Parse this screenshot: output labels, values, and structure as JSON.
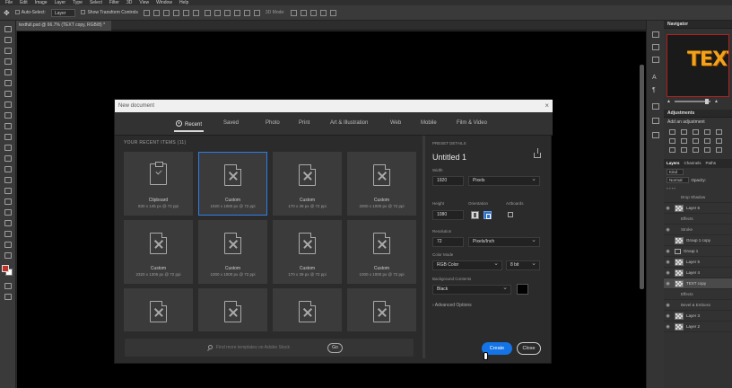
{
  "menubar": [
    "File",
    "Edit",
    "Image",
    "Layer",
    "Type",
    "Select",
    "Filter",
    "3D",
    "View",
    "Window",
    "Help"
  ],
  "options": {
    "auto_select_label": "Auto-Select:",
    "auto_select_value": "Layer",
    "show_transform_label": "Show Transform Controls",
    "mode_3d_label": "3D Mode:"
  },
  "document_tab": "textfull.psd @ 66.7% (TEXT copy, RGB/8) *",
  "navigator": {
    "title": "Navigator",
    "thumbnail_text": "TEXT"
  },
  "adjustments": {
    "title": "Adjustments",
    "add_label": "Add an adjustment"
  },
  "layers_panel": {
    "tabs": [
      "Layers",
      "Channels",
      "Paths"
    ],
    "filter_kind": "Kind",
    "blend_mode": "Normal",
    "opacity_label": "Opacity:",
    "rows": [
      {
        "name": "Drop Shadow",
        "kind": "effect"
      },
      {
        "name": "Layer 6",
        "kind": "layer"
      },
      {
        "name": "Effects",
        "kind": "effect"
      },
      {
        "name": "Stroke",
        "kind": "effect"
      },
      {
        "name": "Group 1 copy",
        "kind": "group"
      },
      {
        "name": "Group 1",
        "kind": "group"
      },
      {
        "name": "Layer 5",
        "kind": "layer"
      },
      {
        "name": "Layer 4",
        "kind": "layer"
      },
      {
        "name": "TEXT copy",
        "kind": "layer"
      },
      {
        "name": "Effects",
        "kind": "effect"
      },
      {
        "name": "Bevel & Emboss",
        "kind": "effect"
      },
      {
        "name": "Layer 3",
        "kind": "layer"
      },
      {
        "name": "Layer 2",
        "kind": "layer"
      }
    ]
  },
  "dialog": {
    "title": "New document",
    "tabs": [
      "Recent",
      "Saved",
      "Photo",
      "Print",
      "Art & Illustration",
      "Web",
      "Mobile",
      "Film & Video"
    ],
    "recent_header": "YOUR RECENT ITEMS (11)",
    "cards": [
      {
        "name": "Clipboard",
        "desc": "830 x 145 px @ 72 ppi",
        "icon": "clipboard"
      },
      {
        "name": "Custom",
        "desc": "1920 x 1080 px @ 72 ppi",
        "icon": "doc",
        "selected": true
      },
      {
        "name": "Custom",
        "desc": "170 x 39 px @ 72 ppi",
        "icon": "doc"
      },
      {
        "name": "Custom",
        "desc": "2000 x 1000 px @ 72 ppi",
        "icon": "doc"
      },
      {
        "name": "Custom",
        "desc": "2320 x 1305 px @ 72 ppi",
        "icon": "doc"
      },
      {
        "name": "Custom",
        "desc": "1000 x 1000 px @ 72 ppi",
        "icon": "doc"
      },
      {
        "name": "Custom",
        "desc": "170 x 39 px @ 72 ppi",
        "icon": "doc"
      },
      {
        "name": "Custom",
        "desc": "1000 x 1000 px @ 72 ppi",
        "icon": "doc"
      },
      {
        "name": "",
        "desc": "",
        "icon": "doc"
      },
      {
        "name": "",
        "desc": "",
        "icon": "doc"
      },
      {
        "name": "",
        "desc": "",
        "icon": "doc"
      },
      {
        "name": "",
        "desc": "",
        "icon": "doc"
      }
    ],
    "search_placeholder": "Find more templates on Adobe Stock",
    "go_label": "Go",
    "details": {
      "header": "PRESET DETAILS",
      "name": "Untitled 1",
      "width_label": "Width",
      "width_value": "1920",
      "width_unit": "Pixels",
      "height_label": "Height",
      "height_value": "1080",
      "orientation_label": "Orientation",
      "artboards_label": "Artboards",
      "resolution_label": "Resolution",
      "resolution_value": "72",
      "resolution_unit": "Pixels/Inch",
      "color_mode_label": "Color Mode",
      "color_mode_value": "RGB Color",
      "bit_depth": "8 bit",
      "bg_label": "Background Contents",
      "bg_value": "Black",
      "advanced_label": "Advanced Options"
    },
    "create_label": "Create",
    "close_label": "Close"
  },
  "colors": {
    "accent": "#1473e6",
    "foreground_swatch": "#c0322a",
    "background_swatch": "#ffffff",
    "thumbnail_text": "#f2a21a"
  }
}
